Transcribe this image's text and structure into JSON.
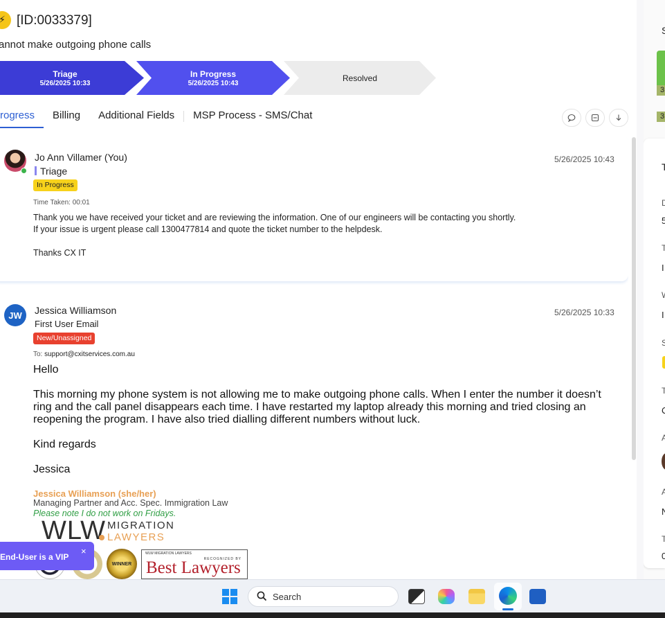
{
  "header": {
    "ticket_id": "[ID:0033379]",
    "subject": "annot make outgoing phone calls"
  },
  "stages": [
    {
      "name": "Triage",
      "date": "5/26/2025 10:33"
    },
    {
      "name": "In Progress",
      "date": "5/26/2025 10:43"
    },
    {
      "name": "Resolved",
      "date": ""
    }
  ],
  "tabs": [
    {
      "label": "rogress",
      "active": true
    },
    {
      "label": "Billing",
      "active": false
    },
    {
      "label": "Additional Fields",
      "active": false
    },
    {
      "label": "MSP Process - SMS/Chat",
      "active": false
    }
  ],
  "tab_actions": [
    "comment-icon",
    "collapse-icon",
    "download-icon"
  ],
  "activities": [
    {
      "author": "Jo Ann Villamer (You)",
      "timestamp": "5/26/2025 10:43",
      "stage": "Triage",
      "status": "In Progress",
      "time_taken": "Time Taken: 00:01",
      "body_lines": [
        "Thank you we have received your ticket and are reviewing the information. One of our engineers will be contacting you shortly.",
        "If your issue is urgent please call 1300477814 and quote the ticket number to the helpdesk.",
        "Thanks CX IT"
      ]
    },
    {
      "author": "Jessica Williamson",
      "initials": "JW",
      "timestamp": "5/26/2025 10:33",
      "stage": "First User Email",
      "status": "New/Unassigned",
      "to_label": "To:",
      "to_address": "support@cxitservices.com.au",
      "greeting": "Hello",
      "paragraph": "This morning my phone system is not allowing me to make outgoing phone calls. When I enter the number it doesn’t ring and the call panel disappears each time. I have restarted my laptop already this morning and tried closing an reopening the program. I have also tried dialling different numbers without luck.",
      "closing": "Kind regards",
      "name": "Jessica",
      "signature": {
        "name": "Jessica Williamson (she/her)",
        "title": "Managing Partner and Acc. Spec. Immigration Law",
        "note": "Please note I do not work on Fridays.",
        "logo_letters": "WLW",
        "logo_word_1": "MIGRATION",
        "logo_word_2": "LAWYERS",
        "award_text": "WINNER",
        "best_lawyers_top": "WLW MIGRATION LAWYERS",
        "best_lawyers_recognized": "RECOGNIZED BY",
        "best_lawyers_name": "Best Lawyers"
      }
    }
  ],
  "vip_toast": {
    "text": "End-User is a VIP",
    "close": "×"
  },
  "right_panel": {
    "letters": [
      "S",
      "3",
      "3",
      "T",
      "D",
      "5",
      "T",
      "I",
      "W",
      "I",
      "S",
      "T",
      "C",
      "A",
      "A",
      "N",
      "T",
      "0"
    ]
  },
  "taskbar": {
    "search_label": "Search"
  },
  "colors": {
    "stage_triage": "#3c3cd6",
    "stage_in_progress": "#5150ee",
    "badge_in_progress": "#f7d21b",
    "badge_new": "#e8412f",
    "vip_toast": "#6d5bf5",
    "tab_active": "#2d5fd3"
  }
}
